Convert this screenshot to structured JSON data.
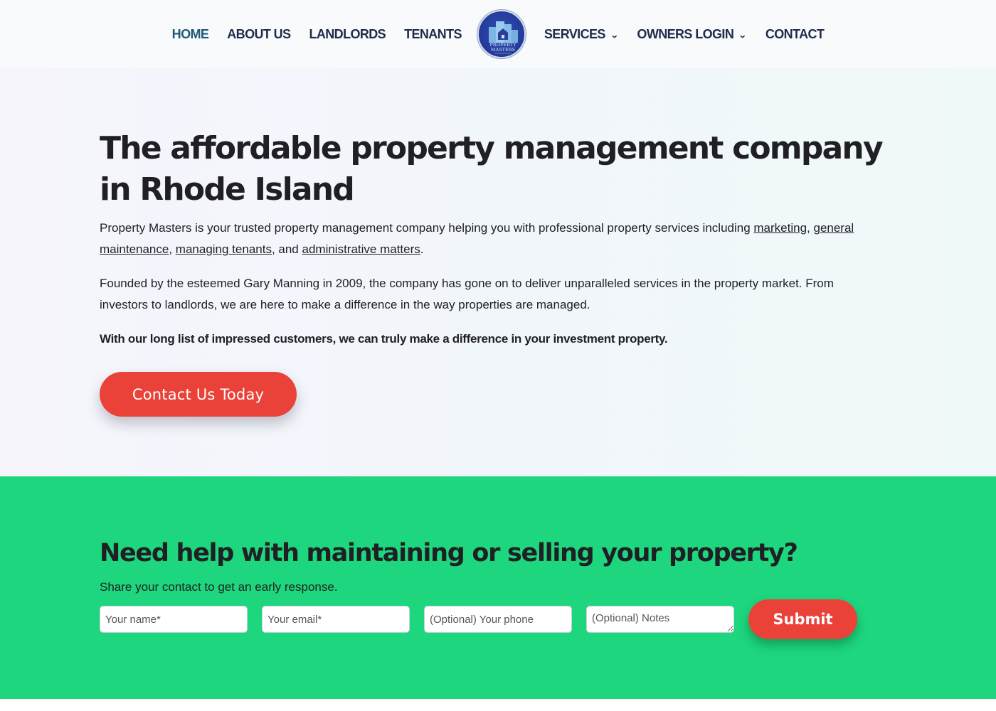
{
  "header": {
    "nav_left": [
      {
        "label": "HOME",
        "active": true
      },
      {
        "label": "ABOUT US"
      },
      {
        "label": "LANDLORDS"
      },
      {
        "label": "TENANTS"
      }
    ],
    "logo": {
      "line1": "PROPERTY",
      "line2": "MASTERS",
      "icon": "house-buildings-logo"
    },
    "nav_right": [
      {
        "label": "SERVICES",
        "dropdown": true,
        "icon": "chevron-down-icon"
      },
      {
        "label": "OWNERS LOGIN",
        "dropdown": true,
        "icon": "chevron-down-icon"
      },
      {
        "label": "CONTACT"
      }
    ]
  },
  "hero": {
    "title": "The affordable property management company in Rhode Island",
    "p1": {
      "intro": "Property Masters is your trusted property management company helping you with professional property services including ",
      "link1": "marketing",
      "sep1": ", ",
      "link2": "general maintenance",
      "sep2": ", ",
      "link3": "managing tenants",
      "sep3": ", and ",
      "link4": "administrative matters",
      "end": "."
    },
    "p2": "Founded by the esteemed Gary Manning in 2009, the company has gone on to deliver unparalleled services in the property market. From investors to landlords, we are here to make a difference in the way properties are managed.",
    "p3": "With our long list of impressed customers, we can truly make a difference in your investment property.",
    "cta_label": "Contact Us Today"
  },
  "contact": {
    "title": "Need help with maintaining or selling your property?",
    "subtitle": "Share your contact to get an early response.",
    "fields": {
      "name_placeholder": "Your name*",
      "email_placeholder": "Your email*",
      "phone_placeholder": "(Optional) Your phone",
      "notes_placeholder": "(Optional) Notes"
    },
    "submit_label": "Submit"
  },
  "colors": {
    "nav_text": "#1f2b4a",
    "nav_active": "#1d5a78",
    "accent_red": "#ea4238",
    "section_green": "#1dd67e",
    "logo_blue": "#22399a"
  }
}
